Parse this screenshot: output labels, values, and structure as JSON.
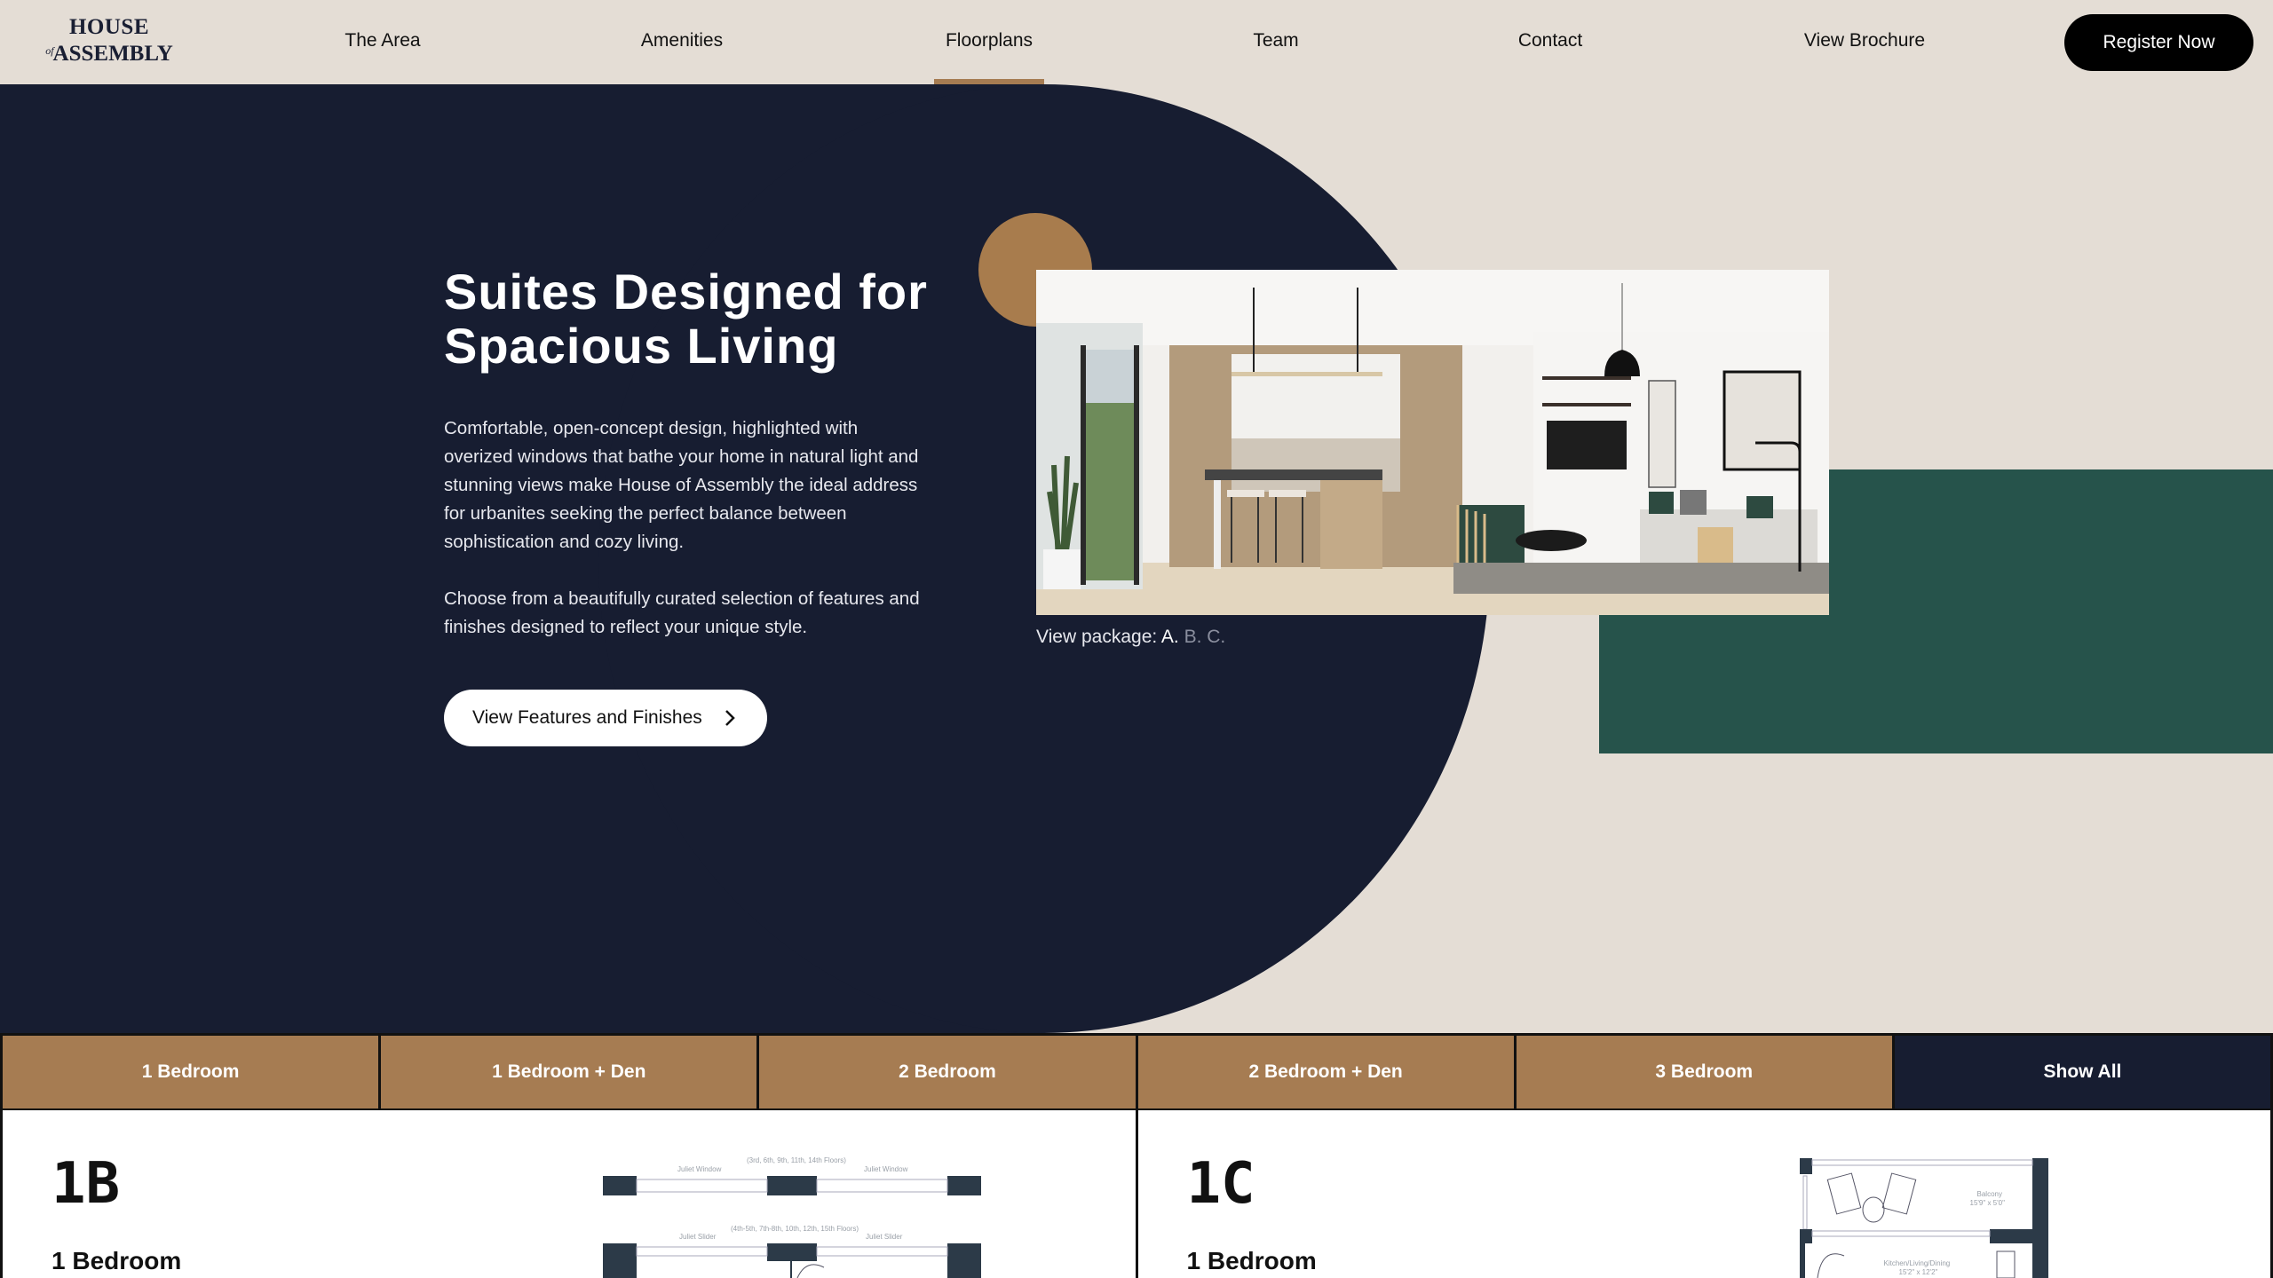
{
  "brand": {
    "logo_line1": "HOUSE",
    "logo_of": "of",
    "logo_line2": "ASSEMBLY"
  },
  "nav": {
    "items": [
      {
        "label": "The Area"
      },
      {
        "label": "Amenities"
      },
      {
        "label": "Floorplans",
        "active": true
      },
      {
        "label": "Team"
      },
      {
        "label": "Contact"
      },
      {
        "label": "View Brochure"
      }
    ],
    "register_label": "Register Now"
  },
  "hero": {
    "title": "Suites Designed for Spacious Living",
    "paragraph1": "Comfortable, open-concept design, highlighted with overized windows that bathe your home in natural light and stunning views make House of Assembly the ideal address for urbanites seeking the perfect balance between sophistication and cozy living.",
    "paragraph2": "Choose from a beautifully curated selection of features and finishes designed to reflect your unique style.",
    "cta_label": "View Features and Finishes",
    "package_label": "View package:",
    "packages": [
      {
        "label": "A.",
        "active": true
      },
      {
        "label": "B.",
        "active": false
      },
      {
        "label": "C.",
        "active": false
      }
    ],
    "image_alt": "interior-kitchen-living-room-rendering"
  },
  "colors": {
    "navy": "#171d31",
    "gold": "#a67c52",
    "green": "#26534b",
    "beige": "#e4ddd5"
  },
  "filter_tabs": [
    {
      "label": "1 Bedroom"
    },
    {
      "label": "1 Bedroom + Den"
    },
    {
      "label": "2 Bedroom"
    },
    {
      "label": "2 Bedroom + Den"
    },
    {
      "label": "3 Bedroom"
    },
    {
      "label": "Show All",
      "active": true
    }
  ],
  "suites": [
    {
      "code": "1B",
      "type": "1 Bedroom",
      "plan_labels": {
        "floors_a": "(3rd, 6th, 9th, 11th, 14th Floors)",
        "window_left": "Juliet Window",
        "window_right": "Juliet Window",
        "floors_b": "(4th-5th, 7th-8th, 10th, 12th, 15th Floors)",
        "slider_left": "Juliet Slider",
        "slider_right": "Juliet Slider"
      }
    },
    {
      "code": "1C",
      "type": "1 Bedroom",
      "plan_labels": {
        "balcony": "Balcony",
        "balcony_size": "15'9\" x 5'0\"",
        "kitchen": "Kitchen/Living/Dining",
        "kitchen_size": "15'2\" x 12'2\""
      }
    }
  ]
}
